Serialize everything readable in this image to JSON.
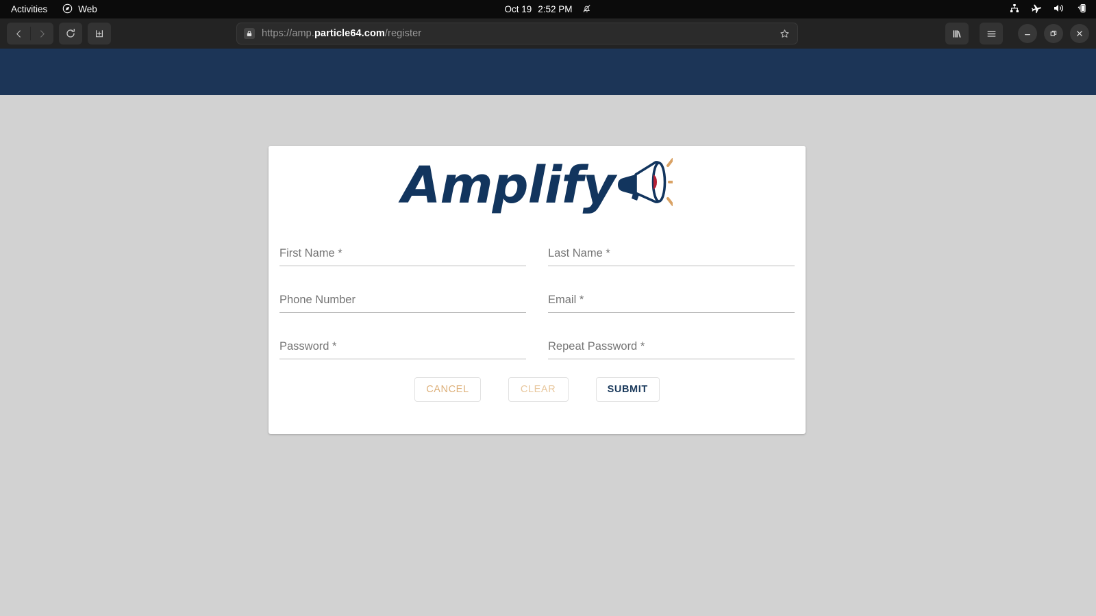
{
  "os_bar": {
    "activities": "Activities",
    "app_name": "Web",
    "app_icon": "compass-icon",
    "clock_date": "Oct 19",
    "clock_time": "2:52 PM",
    "notification_icon": "bell-slash-icon",
    "tray_icons": [
      "network-wired-icon",
      "airplane-mode-icon",
      "volume-icon",
      "battery-charging-icon"
    ]
  },
  "browser": {
    "back_icon": "chevron-left-icon",
    "forward_icon": "chevron-right-icon",
    "reload_icon": "reload-icon",
    "newtab_icon": "new-tab-icon",
    "security_icon": "lock-icon",
    "url_scheme": "https://amp.",
    "url_host": "particle64.com",
    "url_path": "/register",
    "url_full": "https://amp.particle64.com/register",
    "bookmark_icon": "star-icon",
    "library_icon": "library-icon",
    "menu_icon": "hamburger-menu-icon",
    "minimize_icon": "minimize-icon",
    "maximize_icon": "maximize-icon",
    "close_icon": "close-icon"
  },
  "colors": {
    "header_navy": "#1c3557",
    "page_background": "#d2d2d2",
    "logo_navy": "#12355e",
    "logo_accent_tan": "#d9a264",
    "logo_accent_red": "#b51f35",
    "cancel_tan": "#ddb07a",
    "clear_tan": "#e8c79d",
    "submit_navy": "#1b3a5c"
  },
  "app": {
    "logo_text": "Amplify",
    "logo_icon": "megaphone-icon",
    "form": {
      "fields": [
        {
          "name": "first-name",
          "placeholder": "First Name *",
          "value": "",
          "type": "text"
        },
        {
          "name": "last-name",
          "placeholder": "Last Name *",
          "value": "",
          "type": "text"
        },
        {
          "name": "phone-number",
          "placeholder": "Phone Number",
          "value": "",
          "type": "tel"
        },
        {
          "name": "email",
          "placeholder": "Email *",
          "value": "",
          "type": "email"
        },
        {
          "name": "password",
          "placeholder": "Password *",
          "value": "",
          "type": "password"
        },
        {
          "name": "repeat-password",
          "placeholder": "Repeat Password *",
          "value": "",
          "type": "password"
        }
      ],
      "buttons": {
        "cancel": "CANCEL",
        "clear": "CLEAR",
        "submit": "SUBMIT"
      }
    }
  }
}
